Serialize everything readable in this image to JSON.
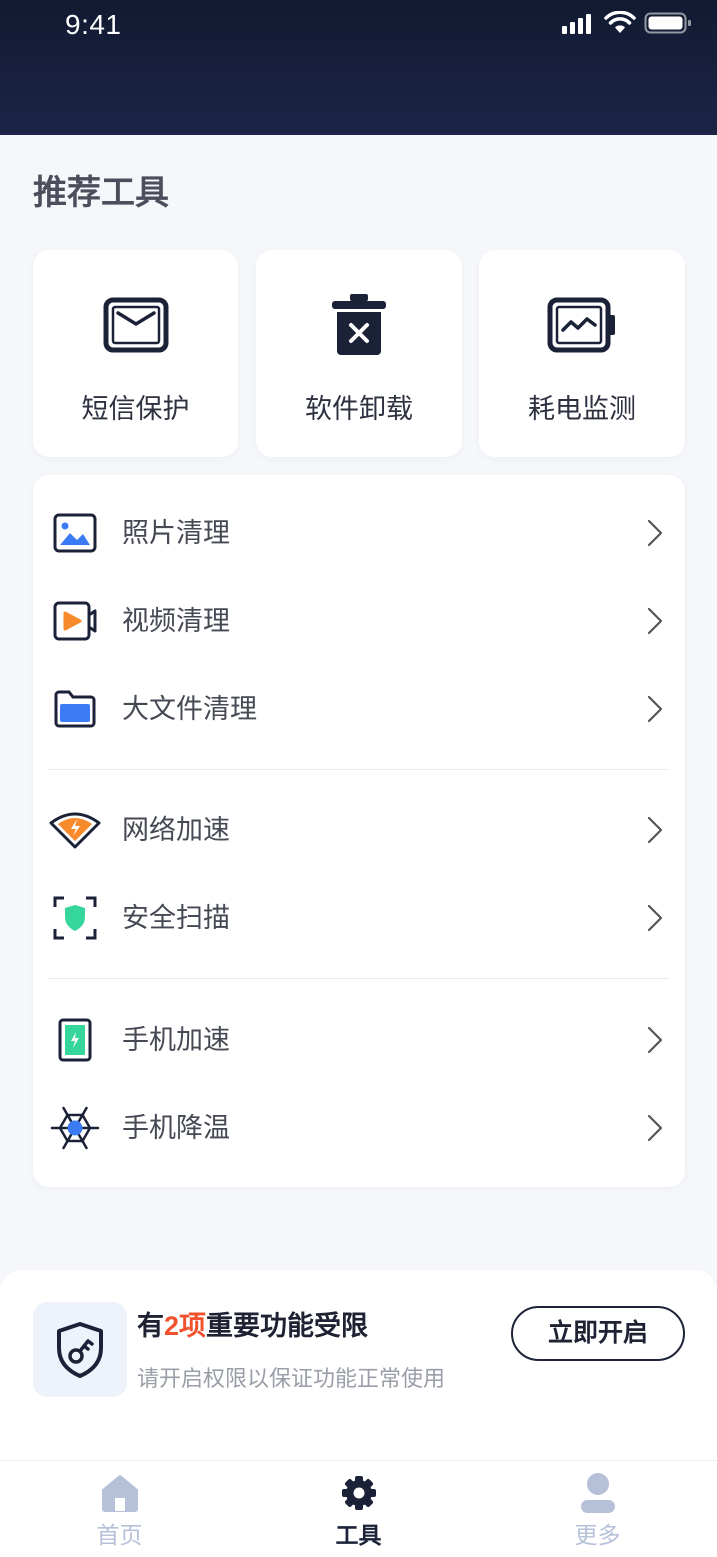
{
  "status_bar": {
    "time": "9:41",
    "icons": [
      "signal-icon",
      "wifi-icon",
      "battery-icon"
    ]
  },
  "section_title": "推荐工具",
  "recommended": [
    {
      "label": "短信保护",
      "icon": "message-icon"
    },
    {
      "label": "软件卸载",
      "icon": "trash-icon"
    },
    {
      "label": "耗电监测",
      "icon": "battery-monitor-icon"
    }
  ],
  "tool_groups": [
    {
      "items": [
        {
          "label": "照片清理",
          "icon": "photo-icon"
        },
        {
          "label": "视频清理",
          "icon": "video-icon"
        },
        {
          "label": "大文件清理",
          "icon": "folder-icon"
        }
      ]
    },
    {
      "items": [
        {
          "label": "网络加速",
          "icon": "wifi-speed-icon"
        },
        {
          "label": "安全扫描",
          "icon": "shield-scan-icon"
        }
      ]
    },
    {
      "items": [
        {
          "label": "手机加速",
          "icon": "phone-boost-icon"
        },
        {
          "label": "手机降温",
          "icon": "cooling-icon"
        }
      ]
    }
  ],
  "permission_banner": {
    "icon": "shield-key-icon",
    "title_prefix": "有",
    "title_highlight": "2项",
    "title_suffix": "重要功能受限",
    "subtitle": "请开启权限以保证功能正常使用",
    "button_label": "立即开启"
  },
  "tab_bar": [
    {
      "label": "首页",
      "icon": "home-icon",
      "active": false
    },
    {
      "label": "工具",
      "icon": "gear-icon",
      "active": true
    },
    {
      "label": "更多",
      "icon": "user-icon",
      "active": false
    }
  ],
  "colors": {
    "header_bg": "#161d3a",
    "page_bg": "#f5f7fb",
    "text_primary": "#1b2238",
    "highlight": "#f0522e",
    "accent_blue": "#3b7cf5",
    "accent_orange": "#f78a2b",
    "accent_green": "#35d69b",
    "tab_inactive": "#b6c1d9"
  }
}
